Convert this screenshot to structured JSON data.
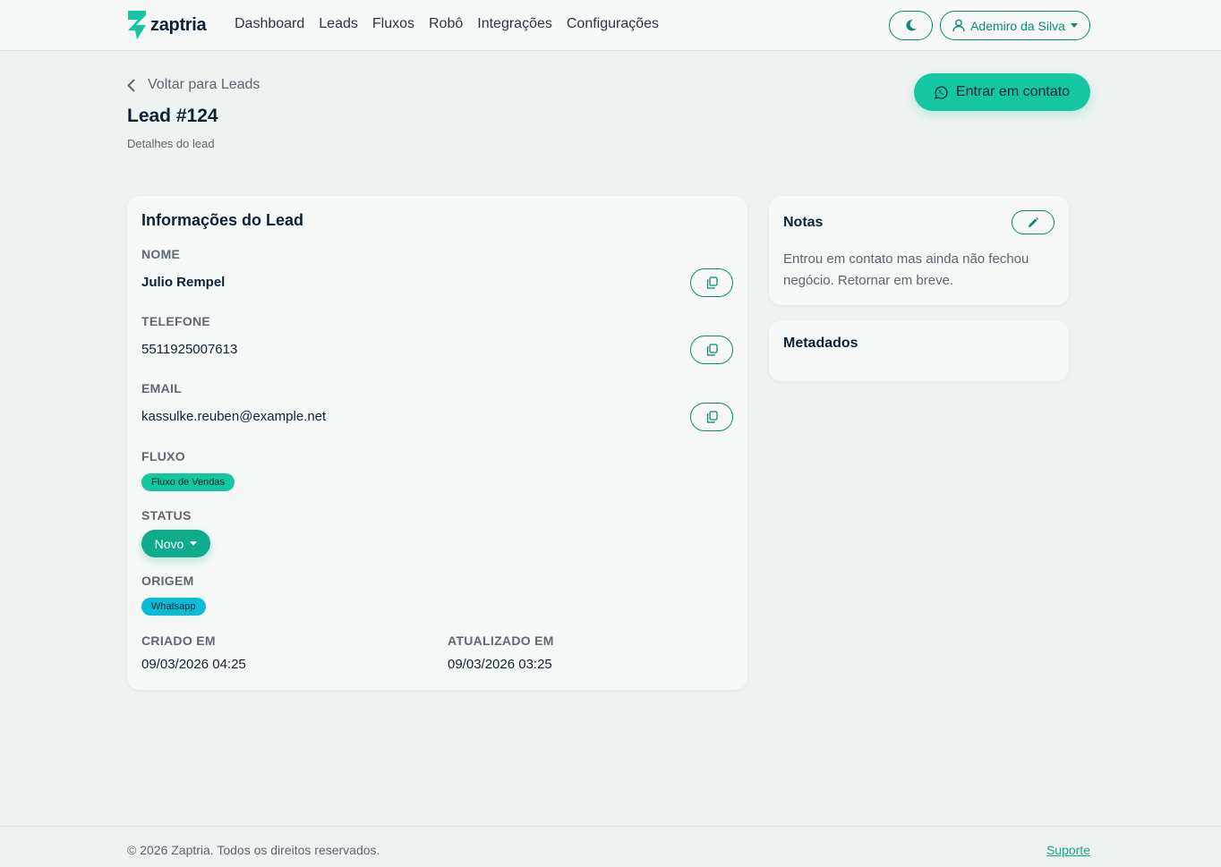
{
  "brand": {
    "name": "zaptria",
    "color": "#14c7a0"
  },
  "nav": {
    "links": [
      "Dashboard",
      "Leads",
      "Fluxos",
      "Robô",
      "Integrações",
      "Configurações"
    ],
    "theme_icon": "moon-icon",
    "user_icon": "user-icon",
    "user_name": "Ademiro da Silva"
  },
  "header": {
    "back_label": "Voltar para Leads",
    "title": "Lead #124",
    "subtitle": "Detalhes do lead",
    "contact_button": "Entrar em contato",
    "contact_icon": "whatsapp-icon"
  },
  "info": {
    "title": "Informações do Lead",
    "nome_label": "NOME",
    "nome": "Julio Rempel",
    "telefone_label": "TELEFONE",
    "telefone": "5511925007613",
    "email_label": "EMAIL",
    "email": "kassulke.reuben@example.net",
    "fluxo_label": "FLUXO",
    "fluxo": "Fluxo de Vendas",
    "status_label": "STATUS",
    "status": "Novo",
    "origem_label": "ORIGEM",
    "origem": "Whatsapp",
    "criado_label": "CRIADO EM",
    "criado": "09/03/2026 04:25",
    "atualizado_label": "ATUALIZADO EM",
    "atualizado": "09/03/2026 03:25",
    "copy_icon": "copy-icon"
  },
  "notes": {
    "title": "Notas",
    "text": "Entrou em contato mas ainda não fechou negócio. Retornar em breve.",
    "edit_icon": "pencil-icon"
  },
  "meta": {
    "title": "Metadados"
  },
  "footer": {
    "copyright": "© 2026 Zaptria. Todos os direitos reservados.",
    "support": "Suporte"
  },
  "colors": {
    "accent": "#14c7a0",
    "accent_dark": "#0e8a74",
    "origem_badge": "#0bbcd6",
    "background": "#eef2f1"
  }
}
